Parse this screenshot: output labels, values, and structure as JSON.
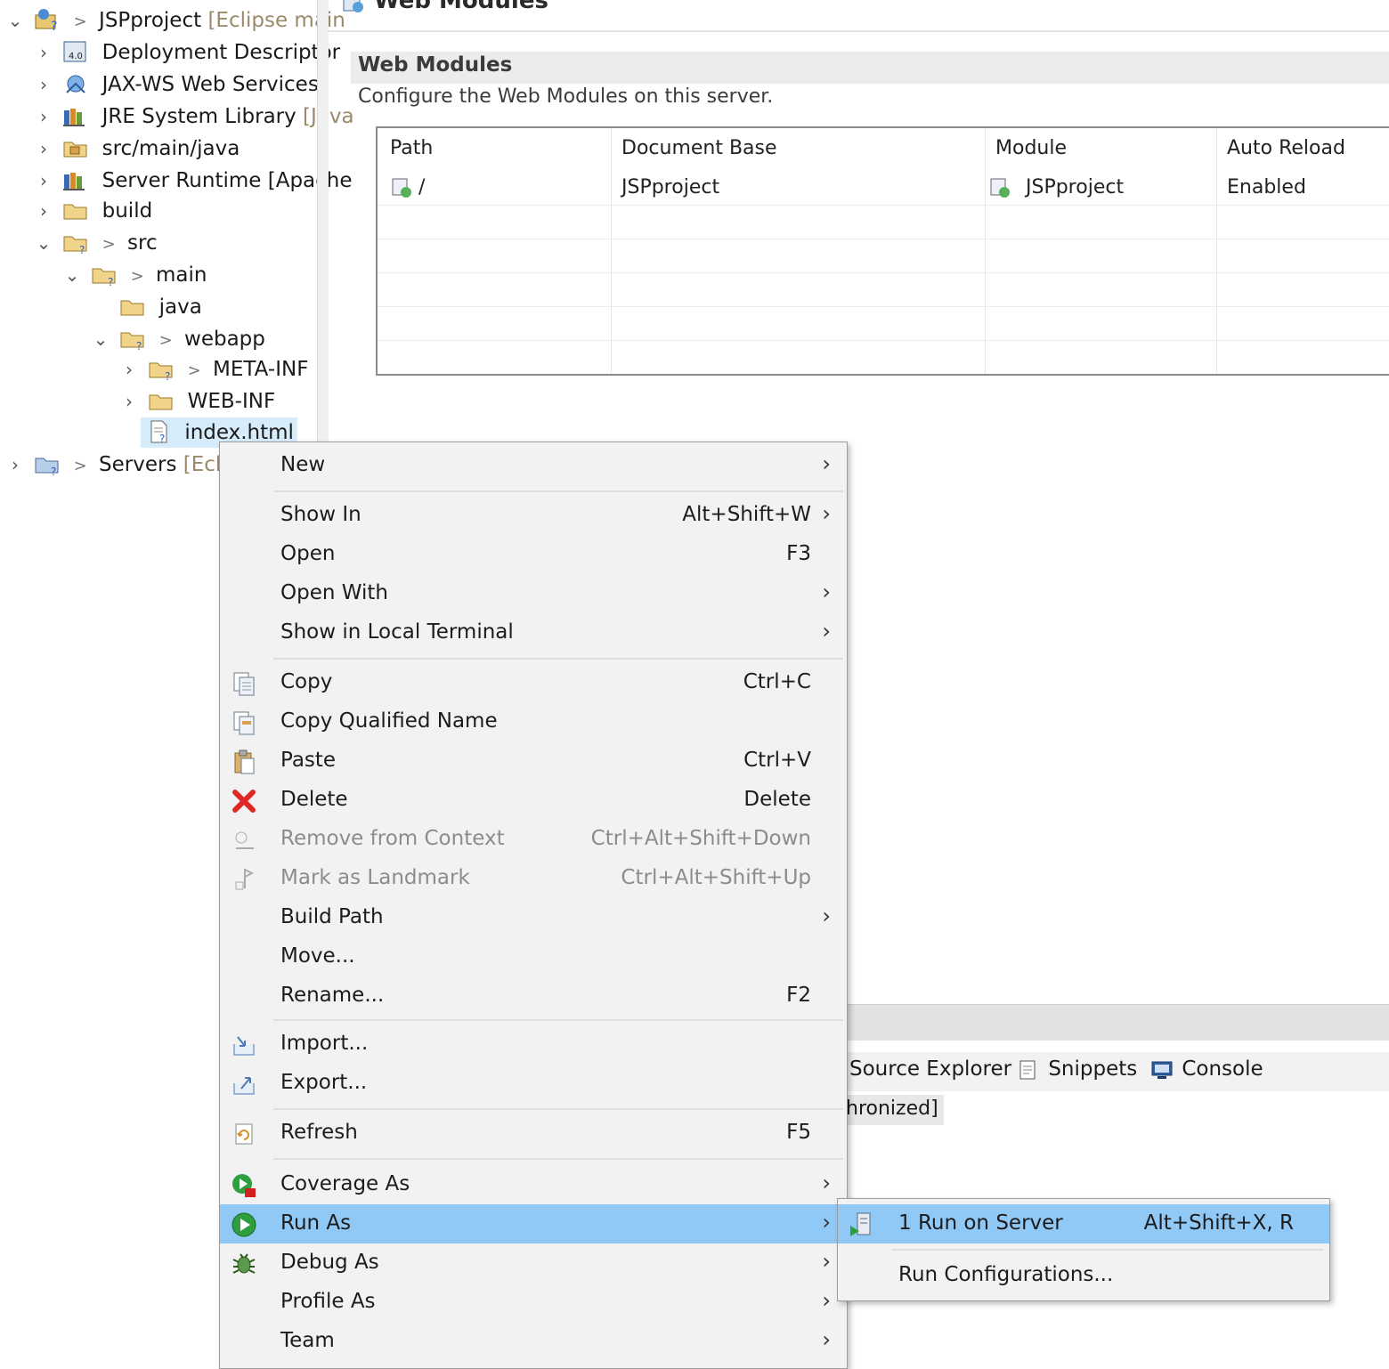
{
  "explorer": {
    "project": {
      "name": "JSPproject",
      "suffix": "[Eclipse main"
    },
    "items": [
      {
        "label": "Deployment Descriptor",
        "icon": "deployment-descriptor-icon"
      },
      {
        "label": "JAX-WS Web Services",
        "icon": "web-services-icon"
      },
      {
        "label": "JRE System Library",
        "suffix": "[Java",
        "icon": "library-icon"
      },
      {
        "label": "src/main/java",
        "icon": "package-folder-icon"
      },
      {
        "label": "Server Runtime [Apache",
        "icon": "library-icon"
      },
      {
        "label": "build",
        "icon": "folder-icon"
      },
      {
        "label": "src",
        "icon": "folder-icon"
      },
      {
        "label": "main",
        "icon": "folder-icon"
      },
      {
        "label": "java",
        "icon": "folder-icon"
      },
      {
        "label": "webapp",
        "icon": "folder-icon"
      },
      {
        "label": "META-INF",
        "icon": "folder-icon"
      },
      {
        "label": "WEB-INF",
        "icon": "folder-icon"
      },
      {
        "label": "index.html",
        "icon": "html-file-icon"
      }
    ],
    "servers": {
      "label": "Servers",
      "suffix": "[Eclips"
    },
    "decorator": ">"
  },
  "editor": {
    "title": "Web Modules",
    "section_title": "Web Modules",
    "section_desc": "Configure the Web Modules on this server.",
    "table": {
      "columns": [
        "Path",
        "Document Base",
        "Module",
        "Auto Reload"
      ],
      "rows": [
        {
          "path": "/",
          "doc_base": "JSPproject",
          "module": "JSPproject",
          "auto_reload": "Enabled"
        }
      ]
    }
  },
  "panel": {
    "tabs": [
      {
        "label": "Source Explorer",
        "icon": "source-explorer-icon"
      },
      {
        "label": "Snippets",
        "icon": "snippets-icon"
      },
      {
        "label": "Console",
        "icon": "console-icon"
      }
    ],
    "sync_text": "hronized]"
  },
  "context_menu": {
    "items": [
      {
        "label": "New",
        "accel": "",
        "submenu": true
      },
      {
        "label": "Show In",
        "accel": "Alt+Shift+W",
        "submenu": true
      },
      {
        "label": "Open",
        "accel": "F3"
      },
      {
        "label": "Open With",
        "accel": "",
        "submenu": true
      },
      {
        "label": "Show in Local Terminal",
        "accel": "",
        "submenu": true
      },
      {
        "label": "Copy",
        "accel": "Ctrl+C",
        "icon": "copy-icon"
      },
      {
        "label": "Copy Qualified Name",
        "accel": "",
        "icon": "copy-qualified-name-icon"
      },
      {
        "label": "Paste",
        "accel": "Ctrl+V",
        "icon": "paste-icon"
      },
      {
        "label": "Delete",
        "accel": "Delete",
        "icon": "delete-icon"
      },
      {
        "label": "Remove from Context",
        "accel": "Ctrl+Alt+Shift+Down",
        "icon": "remove-context-icon",
        "disabled": true
      },
      {
        "label": "Mark as Landmark",
        "accel": "Ctrl+Alt+Shift+Up",
        "icon": "landmark-icon",
        "disabled": true
      },
      {
        "label": "Build Path",
        "accel": "",
        "submenu": true
      },
      {
        "label": "Move...",
        "accel": ""
      },
      {
        "label": "Rename...",
        "accel": "F2"
      },
      {
        "label": "Import...",
        "accel": "",
        "icon": "import-icon"
      },
      {
        "label": "Export...",
        "accel": "",
        "icon": "export-icon"
      },
      {
        "label": "Refresh",
        "accel": "F5",
        "icon": "refresh-icon"
      },
      {
        "label": "Coverage As",
        "accel": "",
        "icon": "coverage-icon",
        "submenu": true
      },
      {
        "label": "Run As",
        "accel": "",
        "icon": "run-icon",
        "submenu": true,
        "active": true
      },
      {
        "label": "Debug As",
        "accel": "",
        "icon": "debug-icon",
        "submenu": true
      },
      {
        "label": "Profile As",
        "accel": "",
        "submenu": true
      },
      {
        "label": "Team",
        "accel": "",
        "submenu": true
      }
    ],
    "arrow": "›"
  },
  "submenu": {
    "items": [
      {
        "label": "1 Run on Server",
        "accel": "Alt+Shift+X, R",
        "icon": "run-on-server-icon",
        "active": true
      },
      {
        "label": "Run Configurations...",
        "accel": ""
      }
    ]
  },
  "colors": {
    "highlight": "#90c8f6",
    "menu_bg": "#f2f2f2",
    "selection": "#d7ecfb"
  }
}
